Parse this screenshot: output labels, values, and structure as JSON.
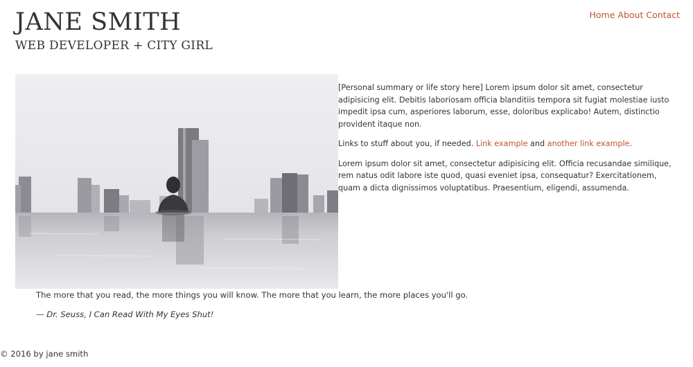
{
  "header": {
    "title": "JANE SMITH",
    "subtitle": "WEB DEVELOPER + CITY GIRL"
  },
  "nav": {
    "items": [
      {
        "label": "Home"
      },
      {
        "label": "About"
      },
      {
        "label": "Contact"
      }
    ]
  },
  "hero_image": {
    "icon": "city-pool-photo"
  },
  "content": {
    "summary": "[Personal summary or life story here] Lorem ipsum dolor sit amet, consectetur adipisicing elit. Debitis laboriosam officia blanditiis tempora sit fugiat molestiae iusto impedit ipsa cum, asperiores laborum, esse, doloribus explicabo! Autem, distinctio provident itaque non.",
    "links_intro": "Links to stuff about you, if needed.",
    "link1": "Link example",
    "links_and": "and",
    "link2": "another link example",
    "links_period": ".",
    "paragraph2": "Lorem ipsum dolor sit amet, consectetur adipisicing elit. Officia recusandae similique, rem natus odit labore iste quod, quasi eveniet ipsa, consequatur? Exercitationem, quam a dicta dignissimos voluptatibus. Praesentium, eligendi, assumenda."
  },
  "quote": {
    "text": "The more that you read, the more things you will know. The more that you learn, the more places you'll go.",
    "citation": "— Dr. Seuss, I Can Read With My Eyes Shut!"
  },
  "footer": {
    "copyright": "© 2016 by jane smith"
  },
  "colors": {
    "link": "#c0552e",
    "text": "#333333",
    "background": "#ffffff"
  }
}
